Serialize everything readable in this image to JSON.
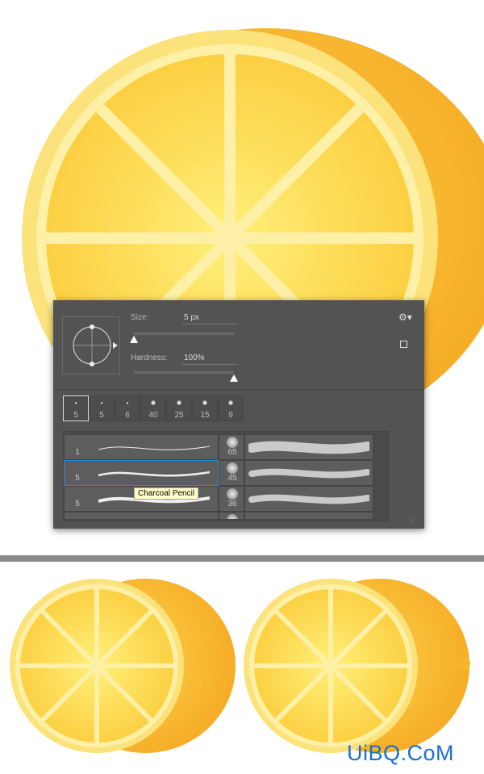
{
  "brush_panel": {
    "size_label": "Size:",
    "size_value": "5 px",
    "size_fraction": 0.0,
    "hardness_label": "Hardness:",
    "hardness_value": "100%",
    "hardness_fraction": 1.0,
    "presets": [
      "5",
      "5",
      "6",
      "40",
      "25",
      "15",
      "9"
    ],
    "brush_rows": [
      {
        "left": "1",
        "right": "65"
      },
      {
        "left": "5",
        "right": "45"
      },
      {
        "left": "5",
        "right": "36"
      },
      {
        "left": "",
        "right": ""
      }
    ],
    "tooltip": "Charcoal Pencil",
    "accent": "#1e90d6"
  },
  "watermark": "UiBQ.CoM",
  "colors": {
    "lemon_rind": "#f7b52a",
    "lemon_pulp": "#fcd640",
    "lemon_pith": "#fdf0a0",
    "panel": "#535353"
  }
}
